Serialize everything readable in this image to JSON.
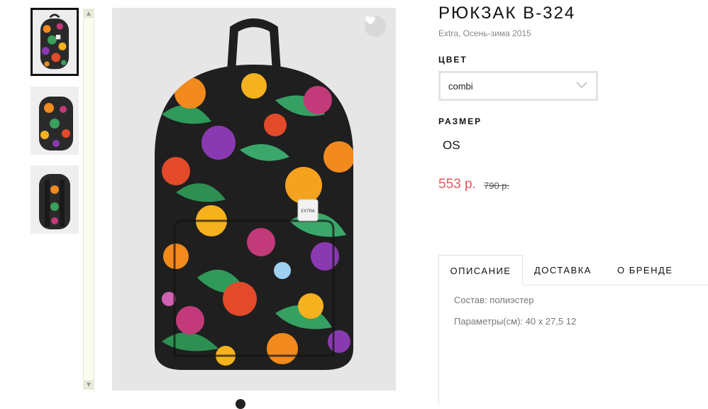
{
  "product": {
    "title": "РЮКЗАК B-324",
    "subtitle": "Extra, Осень-зима 2015"
  },
  "color": {
    "label": "ЦВЕТ",
    "selected": "combi",
    "arrow_icon": "chevron-down-icon"
  },
  "size": {
    "label": "РАЗМЕР",
    "value": "OS"
  },
  "price": {
    "current": "553 р.",
    "old": "790 р.",
    "accent_color": "#e2585c"
  },
  "tabs": [
    {
      "label": "ОПИСАНИЕ",
      "active": true
    },
    {
      "label": "ДОСТАВКА",
      "active": false
    },
    {
      "label": "О БРЕНДЕ",
      "active": false
    }
  ],
  "description": {
    "lines": [
      "Состав: полиэстер",
      "Параметры(см): 40 x 27,5 12"
    ]
  },
  "image": {
    "patch_text": "EXTRA",
    "favorite_icon": "heart-icon"
  }
}
